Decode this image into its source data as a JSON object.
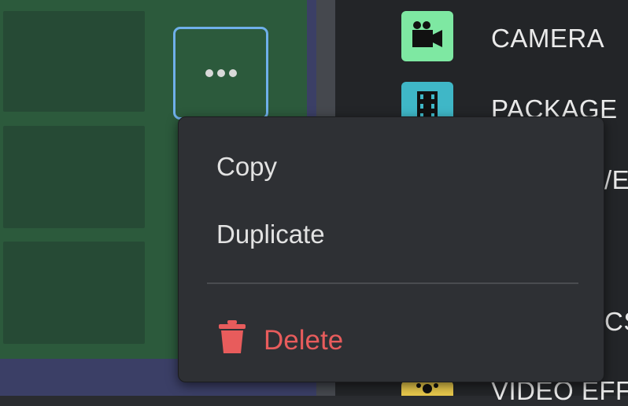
{
  "more_button": {
    "icon": "ellipsis-icon"
  },
  "asset_list": {
    "items": [
      {
        "label": "CAMERA",
        "icon": "camera-icon",
        "color": "#7ee8a2"
      },
      {
        "label": "PACKAGE",
        "icon": "film-icon",
        "color": "#3fb7c7"
      },
      {
        "label": "/E",
        "icon": "",
        "color": ""
      },
      {
        "label": "CS",
        "icon": "",
        "color": ""
      },
      {
        "label": "VIDEO EFF",
        "icon": "video-effect-icon",
        "color": "#e8c84b"
      }
    ]
  },
  "context_menu": {
    "copy_label": "Copy",
    "duplicate_label": "Duplicate",
    "delete_label": "Delete",
    "delete_color": "#e85c5c"
  },
  "colors": {
    "card_green": "#2c5a3c",
    "accent_blue": "#6fb0ea",
    "menu_bg": "#2e3034"
  }
}
